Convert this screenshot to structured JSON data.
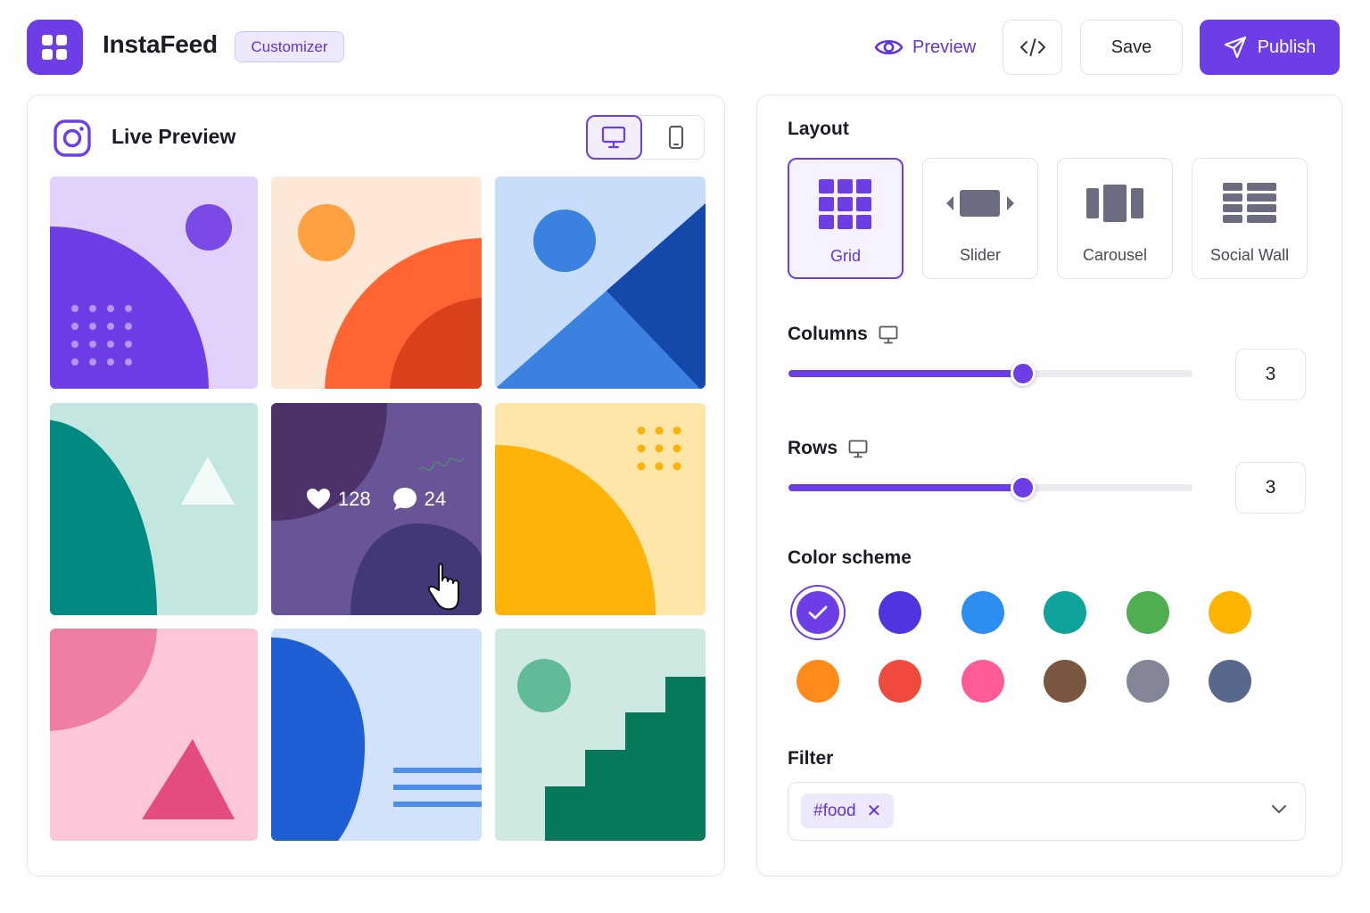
{
  "header": {
    "app_name": "InstaFeed",
    "badge": "Customizer",
    "preview_label": "Preview",
    "save_label": "Save",
    "publish_label": "Publish"
  },
  "preview": {
    "title": "Live Preview",
    "hover_stats": {
      "likes": "128",
      "comments": "24"
    }
  },
  "settings": {
    "layout_label": "Layout",
    "layouts": [
      {
        "label": "Grid",
        "selected": true
      },
      {
        "label": "Slider",
        "selected": false
      },
      {
        "label": "Carousel",
        "selected": false
      },
      {
        "label": "Social Wall",
        "selected": false
      }
    ],
    "columns_label": "Columns",
    "columns_value": "3",
    "columns_fraction": 0.58,
    "rows_label": "Rows",
    "rows_value": "3",
    "rows_fraction": 0.58,
    "color_scheme_label": "Color scheme",
    "colors": [
      "#6d3ee6",
      "#4f35e0",
      "#2b8ef0",
      "#0ea39b",
      "#4fae50",
      "#ffb400",
      "#ff8c1a",
      "#f04a3c",
      "#ff5b96",
      "#7b5640",
      "#838697",
      "#5a678d"
    ],
    "selected_color_index": 0,
    "filter_label": "Filter",
    "filter_tag": "#food"
  }
}
